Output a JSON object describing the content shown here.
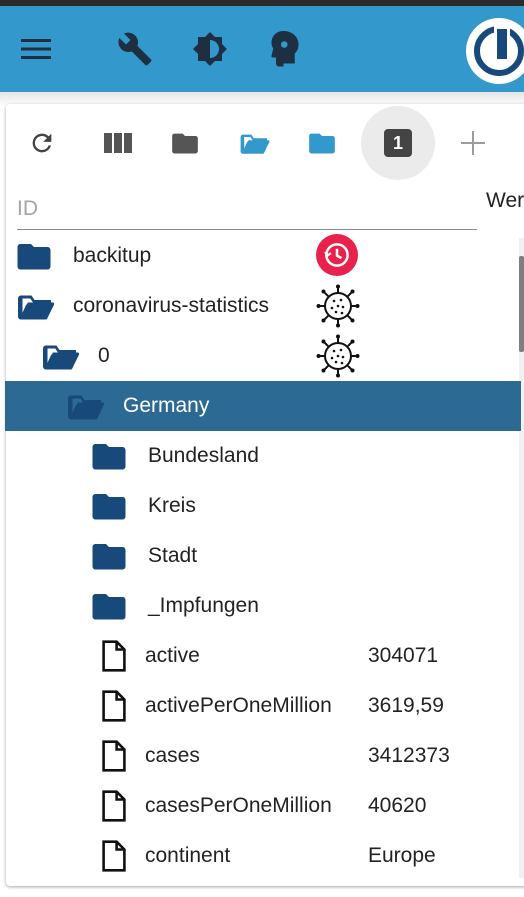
{
  "toolbar_top": {
    "menu_icon": "menu-icon",
    "wrench_icon": "wrench-icon",
    "brightness_icon": "brightness-icon",
    "expert_icon": "head-profile-icon",
    "logo": "iobroker-logo"
  },
  "object_toolbar": {
    "refresh_icon": "refresh-icon",
    "columns_icon": "columns-icon",
    "folder_icon": "folder-closed-icon",
    "folder_open_icon": "folder-open-icon",
    "folder_blue_icon": "folder-icon",
    "counter_label": "1",
    "add_icon": "plus-icon"
  },
  "filter": {
    "id_placeholder": "ID",
    "id_value": "",
    "value_header": "Wer"
  },
  "colors": {
    "appbar": "#3399cc",
    "folder": "#174a7a",
    "selected_row": "#2c6a93",
    "badge": "#e8224b"
  },
  "tree": [
    {
      "label": "backitup",
      "icon": "folder-closed-icon",
      "value": "",
      "extra": "backup-clock-icon"
    },
    {
      "label": "coronavirus-statistics",
      "icon": "folder-open-icon",
      "value": "",
      "extra": "virus-icon"
    },
    {
      "label": "0",
      "icon": "folder-open-icon",
      "value": "",
      "extra": "virus-icon"
    },
    {
      "label": "Germany",
      "icon": "folder-open-icon",
      "value": "",
      "extra": ""
    },
    {
      "label": "Bundesland",
      "icon": "folder-closed-icon",
      "value": "",
      "extra": ""
    },
    {
      "label": "Kreis",
      "icon": "folder-closed-icon",
      "value": "",
      "extra": ""
    },
    {
      "label": "Stadt",
      "icon": "folder-closed-icon",
      "value": "",
      "extra": ""
    },
    {
      "label": "_Impfungen",
      "icon": "folder-closed-icon",
      "value": "",
      "extra": ""
    },
    {
      "label": "active",
      "icon": "file-icon",
      "value": "304071",
      "extra": ""
    },
    {
      "label": "activePerOneMillion",
      "icon": "file-icon",
      "value": "3619,59",
      "extra": ""
    },
    {
      "label": "cases",
      "icon": "file-icon",
      "value": "3412373",
      "extra": ""
    },
    {
      "label": "casesPerOneMillion",
      "icon": "file-icon",
      "value": "40620",
      "extra": ""
    },
    {
      "label": "continent",
      "icon": "file-icon",
      "value": "Europe",
      "extra": ""
    }
  ]
}
